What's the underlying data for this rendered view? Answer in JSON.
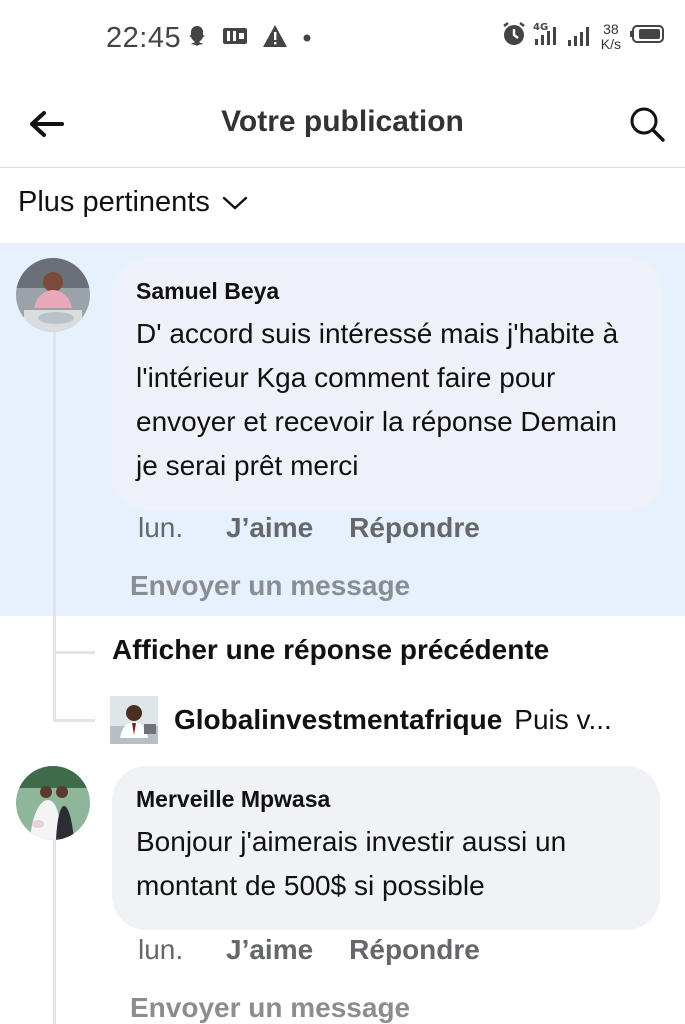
{
  "status_bar": {
    "time": "22:45",
    "speed_value": "38",
    "speed_unit": "K/s",
    "network": "4G"
  },
  "header": {
    "title": "Votre publication"
  },
  "sort": {
    "label": "Plus pertinents"
  },
  "comments": [
    {
      "author": "Samuel Beya",
      "text": "D' accord suis intéressé mais j'habite à l'intérieur Kga comment faire pour envoyer et recevoir la réponse Demain je serai prêt merci",
      "time": "lun.",
      "like_label": "J’aime",
      "reply_label": "Répondre",
      "send_message_label": "Envoyer un message"
    },
    {
      "author": "Merveille Mpwasa",
      "text": "Bonjour j'aimerais investir aussi un montant de 500$ si possible",
      "time": "lun.",
      "like_label": "J’aime",
      "reply_label": "Répondre",
      "send_message_label": "Envoyer un message"
    }
  ],
  "thread": {
    "previous_reply_label": "Afficher une réponse précédente",
    "reply_author": "Globalinvestmentafrique",
    "reply_snippet": "Puis v..."
  }
}
